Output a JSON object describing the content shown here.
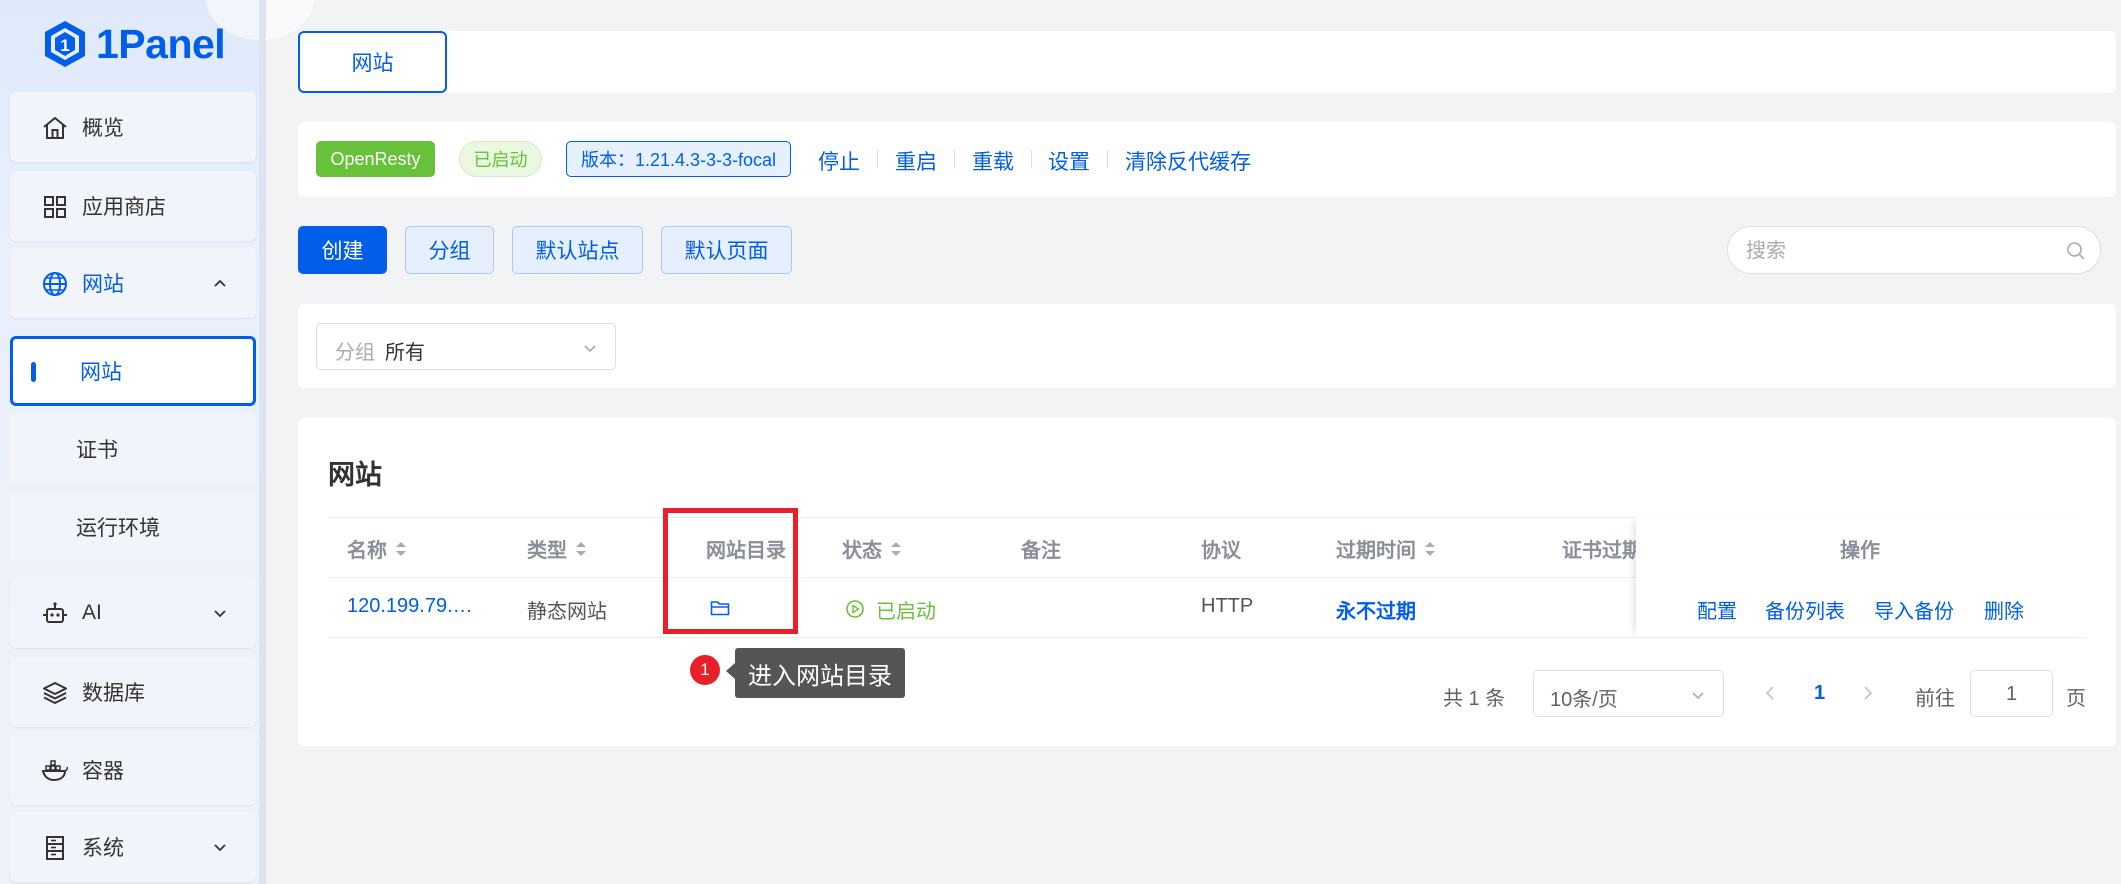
{
  "brand": {
    "logo_text": "1Panel",
    "primary_color": "#005eeb"
  },
  "sidebar": {
    "items": [
      {
        "label": "概览",
        "icon": "home-icon"
      },
      {
        "label": "应用商店",
        "icon": "grid-icon"
      },
      {
        "label": "网站",
        "icon": "globe-icon",
        "expanded": true
      },
      {
        "label": "AI",
        "icon": "robot-icon"
      },
      {
        "label": "数据库",
        "icon": "layers-icon"
      },
      {
        "label": "容器",
        "icon": "docker-icon"
      },
      {
        "label": "系统",
        "icon": "server-icon"
      }
    ],
    "subitems": [
      {
        "label": "网站",
        "selected": true
      },
      {
        "label": "证书"
      },
      {
        "label": "运行环境"
      }
    ]
  },
  "tabs": [
    {
      "label": "网站",
      "active": true
    }
  ],
  "app_bar": {
    "name": "OpenResty",
    "status": "已启动",
    "version": "版本：1.21.4.3-3-3-focal",
    "actions": [
      "停止",
      "重启",
      "重载",
      "设置",
      "清除反代缓存"
    ]
  },
  "toolbar": {
    "create": "创建",
    "group": "分组",
    "default_site": "默认站点",
    "default_page": "默认页面",
    "search_placeholder": "搜索"
  },
  "filter": {
    "label": "分组",
    "value": "所有"
  },
  "table": {
    "title": "网站",
    "columns": [
      "名称",
      "类型",
      "网站目录",
      "状态",
      "备注",
      "协议",
      "过期时间",
      "证书过期",
      "操作"
    ],
    "rows": [
      {
        "name": "120.199.79.…",
        "type": "静态网站",
        "dir_icon": "folder-icon",
        "status": "已启动",
        "remark": "",
        "protocol": "HTTP",
        "expire": "永不过期",
        "cert_expire": "",
        "ops": [
          "配置",
          "备份列表",
          "导入备份",
          "删除"
        ]
      }
    ]
  },
  "annotation": {
    "number": "1",
    "tooltip": "进入网站目录"
  },
  "pagination": {
    "total": "共 1 条",
    "page_size": "10条/页",
    "current": "1",
    "goto_label": "前往",
    "goto_value": "1",
    "page_suffix": "页"
  }
}
